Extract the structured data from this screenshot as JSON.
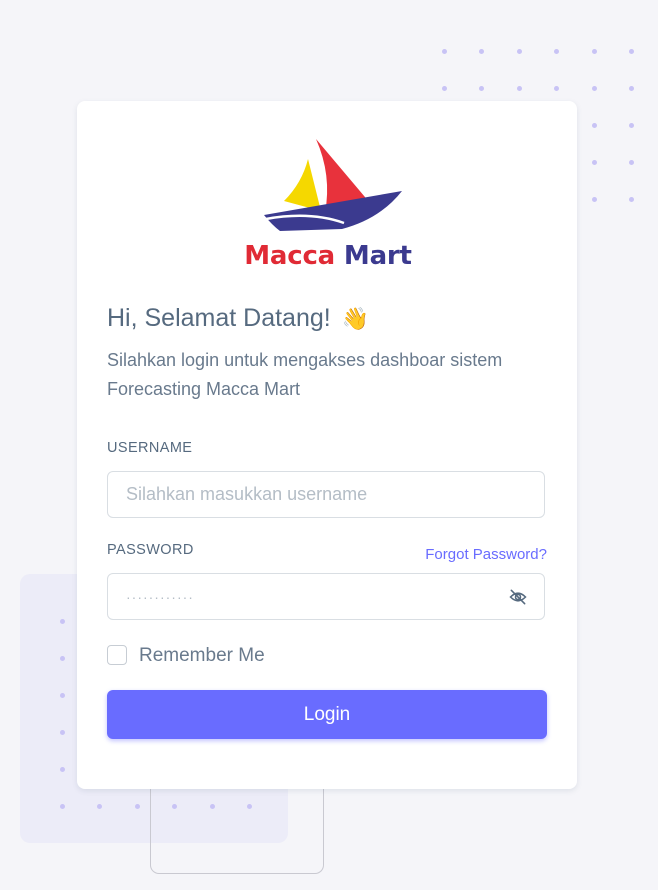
{
  "brand": {
    "name_part1": "Macca",
    "name_part2": "Mart",
    "color_red": "#e02a35",
    "color_navy": "#3b3a8f",
    "color_yellow": "#f5d800"
  },
  "header": {
    "title": "Hi, Selamat Datang!",
    "title_emoji": "👋",
    "subtitle": "Silahkan login untuk mengakses dashboar sistem Forecasting Macca Mart"
  },
  "form": {
    "username_label": "USERNAME",
    "username_placeholder": "Silahkan masukkan username",
    "password_label": "PASSWORD",
    "password_placeholder": "············",
    "forgot_password": "Forgot Password?",
    "password_toggle_icon": "eye-off-icon",
    "remember_me": "Remember Me",
    "remember_checked": false,
    "login_button": "Login"
  },
  "colors": {
    "primary": "#696cff",
    "background": "#f5f5f9",
    "text": "#566a7f"
  }
}
